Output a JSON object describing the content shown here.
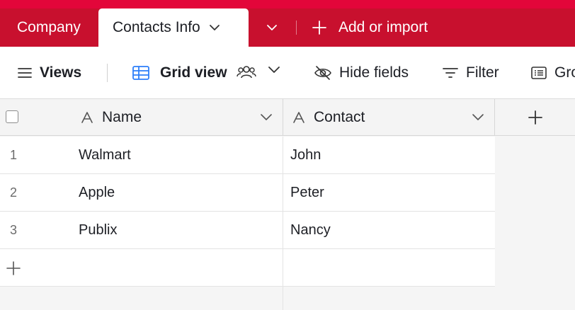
{
  "tabs": {
    "company": "Company",
    "active": "Contacts Info",
    "add_import": "Add or import"
  },
  "toolbar": {
    "views": "Views",
    "grid_view": "Grid view",
    "hide_fields": "Hide fields",
    "filter": "Filter",
    "group": "Gro"
  },
  "columns": {
    "name": "Name",
    "contact": "Contact"
  },
  "rows": [
    {
      "num": "1",
      "name": "Walmart",
      "contact": "John"
    },
    {
      "num": "2",
      "name": "Apple",
      "contact": "Peter"
    },
    {
      "num": "3",
      "name": "Publix",
      "contact": "Nancy"
    }
  ],
  "colors": {
    "brand": "#c8102e",
    "brand_top": "#e3063a",
    "grid_icon": "#2d7ff9"
  },
  "icons": [
    "chevron-down-icon",
    "plus-icon",
    "menu-icon",
    "grid-icon",
    "collaborators-icon",
    "eye-off-icon",
    "filter-icon",
    "group-icon",
    "text-field-icon"
  ]
}
